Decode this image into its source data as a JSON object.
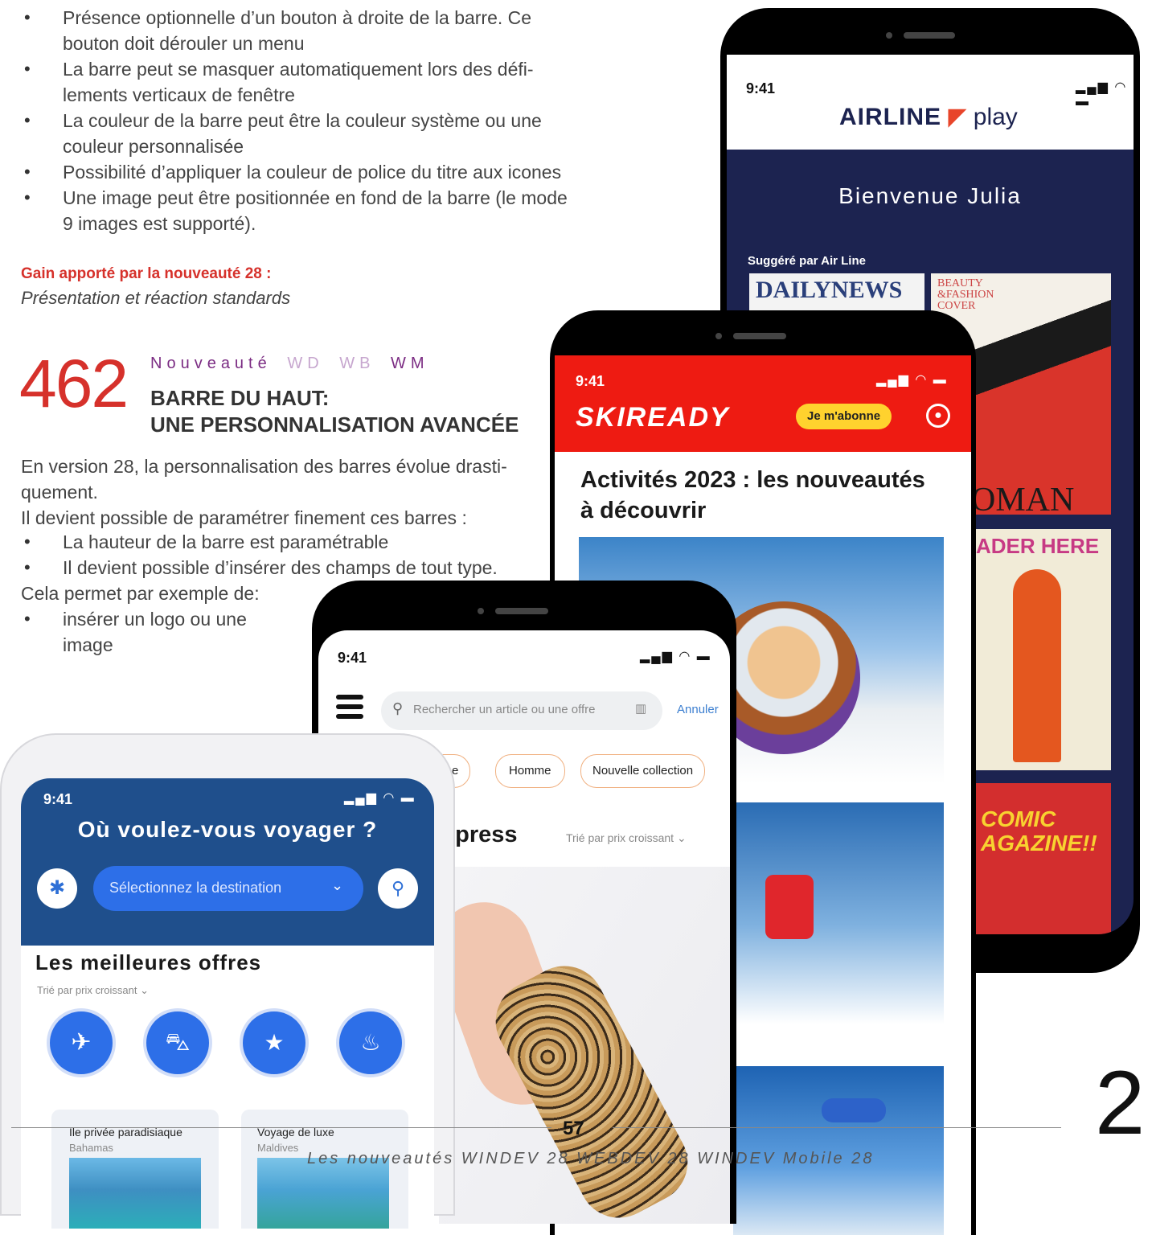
{
  "left_text": {
    "bullets_top": [
      "Présence optionnelle d’un bouton à droite de la barre. Ce bouton doit dérouler un menu",
      "La barre peut se masquer automatiquement lors des défi-lements verticaux de fenêtre",
      "La couleur de la barre peut être la couleur système ou une couleur personnalisée",
      "Possibilité d’appliquer la couleur de police du titre aux icones",
      "Une image peut être positionnée en fond de la barre (le mode 9 images est supporté)."
    ],
    "gain_label": "Gain apporté par la nouveauté 28 :",
    "gain_text": "Présentation et réaction standards"
  },
  "section": {
    "number": "462",
    "kicker": "Nouveauté",
    "tags": [
      "WD",
      "WB",
      "WM"
    ],
    "title_line1": "BARRE DU HAUT:",
    "title_line2": "UNE PERSONNALISATION AVANCÉE",
    "intro1": "En version 28, la personnalisation des barres évolue drasti-quement.",
    "intro2": "Il devient possible de paramétrer finement ces barres :",
    "bullets": [
      "La hauteur de la barre est paramétrable",
      "Il devient possible d’insérer des champs de tout type."
    ],
    "after": "Cela permet par exemple de:",
    "bullet_last": "insérer un logo ou une image"
  },
  "phone_airline": {
    "time": "9:41",
    "brand": "AIRLINE",
    "brand2": "play",
    "welcome": "Bienvenue Julia",
    "suggested": "Suggéré par Air Line",
    "mag1": "DAILYNEWS",
    "mag2": "BEAUTY &FASHION COVER",
    "mag3": "OMAN",
    "mag4": "ADER HERE",
    "mag5": "COMIC AGAZINE!!"
  },
  "phone_ski": {
    "time": "9:41",
    "logo": "SKIREADY",
    "subscribe": "Je m'abonne",
    "headline": "Activités 2023 : les nouveautés à découvrir"
  },
  "phone_shop": {
    "time": "9:41",
    "search_placeholder": "Rechercher un article ou une offre",
    "cancel": "Annuler",
    "chips": [
      "mme",
      "Homme",
      "Nouvelle collection"
    ],
    "section_title": "xpress",
    "sort": "Trié par prix croissant"
  },
  "phone_travel": {
    "time": "9:41",
    "title": "Où voulez-vous voyager ?",
    "select": "Sélectionnez la destination",
    "offers": "Les meilleures offres",
    "sort": "Trié par prix croissant",
    "card1_title": "Ile privée paradisiaque",
    "card1_sub": "Bahamas",
    "card2_title": "Voyage de luxe",
    "card2_sub": "Maldives"
  },
  "footer": {
    "page": "57",
    "caption": "Les nouveautés WINDEV 28  WEBDEV 28  WINDEV Mobile 28",
    "chapter": "2"
  },
  "colors": {
    "red_accent": "#d6312b",
    "purple": "#7b2c83",
    "airline_bg": "#1c2350",
    "ski_red": "#ee1b12",
    "travel_blue": "#1f4f8c"
  }
}
